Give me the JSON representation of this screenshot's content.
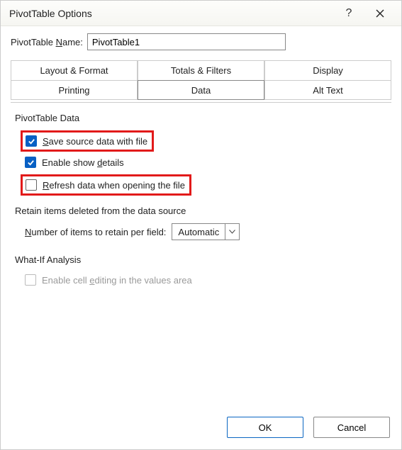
{
  "titlebar": {
    "title": "PivotTable Options"
  },
  "name": {
    "label_pre": "PivotTable ",
    "label_u": "N",
    "label_post": "ame:",
    "value": "PivotTable1"
  },
  "tabs": {
    "row1": [
      "Layout & Format",
      "Totals & Filters",
      "Display"
    ],
    "row2": [
      "Printing",
      "Data",
      "Alt Text"
    ],
    "active": "Data"
  },
  "data_tab": {
    "group1_label": "PivotTable Data",
    "save_source": {
      "u": "S",
      "rest": "ave source data with file",
      "checked": true
    },
    "show_details": {
      "pre": "Enable show ",
      "u": "d",
      "post": "etails",
      "checked": true
    },
    "refresh_open": {
      "u": "R",
      "rest": "efresh data when opening the file",
      "checked": false
    },
    "retain_label": "Retain items deleted from the data source",
    "retain_field": {
      "u": "N",
      "rest": "umber of items to retain per field:",
      "value": "Automatic"
    },
    "group2_label": "What-If Analysis",
    "cell_edit": {
      "pre": "Enable cell ",
      "u": "e",
      "post": "diting in the values area",
      "checked": false,
      "disabled": true
    }
  },
  "footer": {
    "ok": "OK",
    "cancel": "Cancel"
  }
}
